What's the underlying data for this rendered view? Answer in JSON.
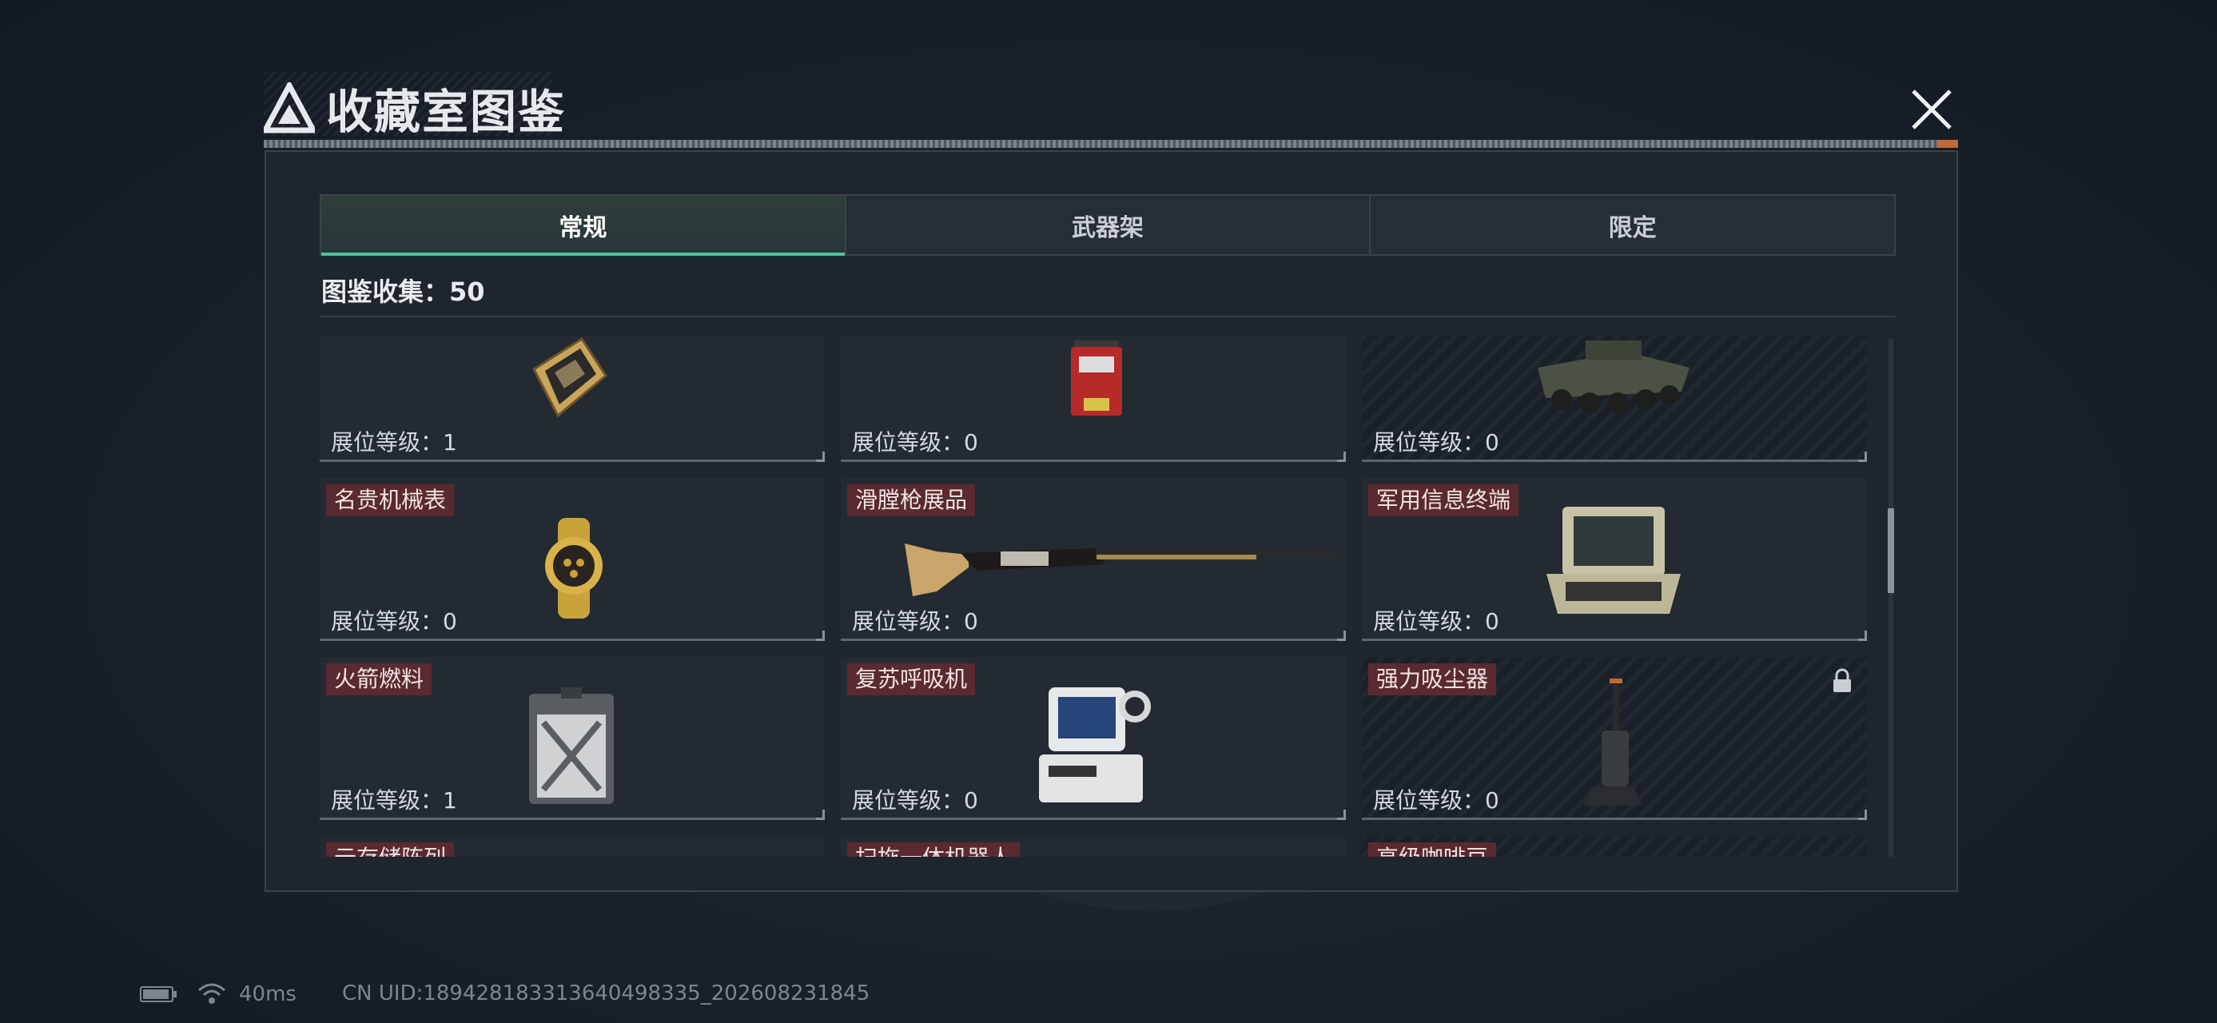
{
  "title": "收藏室图鉴",
  "tabs": [
    {
      "label": "常规",
      "active": true
    },
    {
      "label": "武器架",
      "active": false
    },
    {
      "label": "限定",
      "active": false
    }
  ],
  "collection": {
    "label": "图鉴收集：",
    "count": "50"
  },
  "items": [
    {
      "name": "",
      "level": "展位等级：1",
      "locked": false,
      "icon": "chip-card"
    },
    {
      "name": "",
      "level": "展位等级：0",
      "locked": false,
      "icon": "red-device"
    },
    {
      "name": "",
      "level": "展位等级：0",
      "locked": false,
      "icon": "armored-vehicle"
    },
    {
      "name": "名贵机械表",
      "level": "展位等级：0",
      "locked": false,
      "icon": "gold-watch"
    },
    {
      "name": "滑膛枪展品",
      "level": "展位等级：0",
      "locked": false,
      "icon": "musket"
    },
    {
      "name": "军用信息终端",
      "level": "展位等级：0",
      "locked": false,
      "icon": "military-terminal"
    },
    {
      "name": "火箭燃料",
      "level": "展位等级：1",
      "locked": false,
      "icon": "fuel-canister"
    },
    {
      "name": "复苏呼吸机",
      "level": "展位等级：0",
      "locked": false,
      "icon": "ventilator"
    },
    {
      "name": "强力吸尘器",
      "level": "展位等级：0",
      "locked": true,
      "icon": "vacuum-cleaner"
    },
    {
      "name": "云存储阵列",
      "level": "",
      "locked": false,
      "icon": ""
    },
    {
      "name": "扫拖一体机器人",
      "level": "",
      "locked": false,
      "icon": ""
    },
    {
      "name": "高级咖啡豆",
      "level": "",
      "locked": false,
      "icon": ""
    }
  ],
  "status": {
    "ping": "40ms",
    "uid": "CN UID:18942818331364049833​5_202608231845"
  }
}
